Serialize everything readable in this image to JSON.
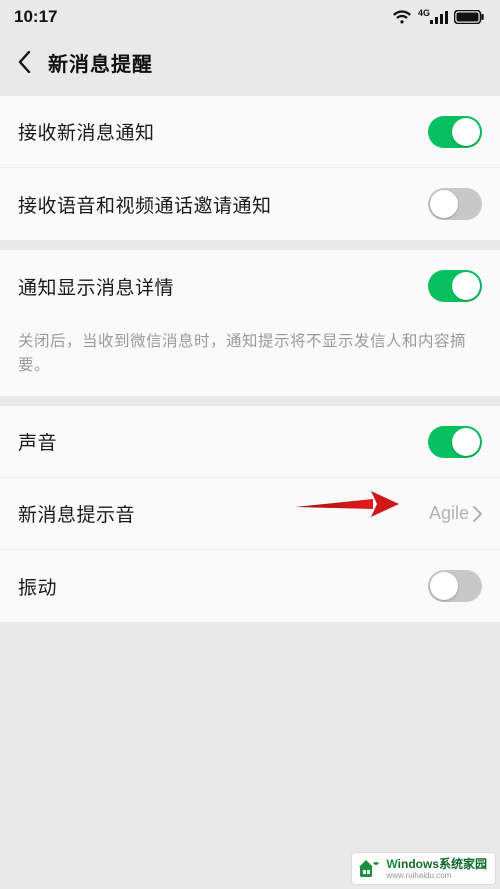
{
  "status": {
    "time": "10:17",
    "network_label": "4G"
  },
  "header": {
    "title": "新消息提醒"
  },
  "group1": {
    "receive_msg": {
      "label": "接收新消息通知",
      "on": true
    },
    "receive_call": {
      "label": "接收语音和视频通话邀请通知",
      "on": false
    }
  },
  "group2": {
    "show_detail": {
      "label": "通知显示消息详情",
      "on": true
    },
    "desc": "关闭后，当收到微信消息时，通知提示将不显示发信人和内容摘要。"
  },
  "group3": {
    "sound": {
      "label": "声音",
      "on": true
    },
    "tone": {
      "label": "新消息提示音",
      "value": "Agile"
    },
    "vibrate": {
      "label": "振动",
      "on": false
    }
  },
  "watermark": {
    "main": "indows系统家园",
    "sub": "www.ruihaidu.com"
  }
}
